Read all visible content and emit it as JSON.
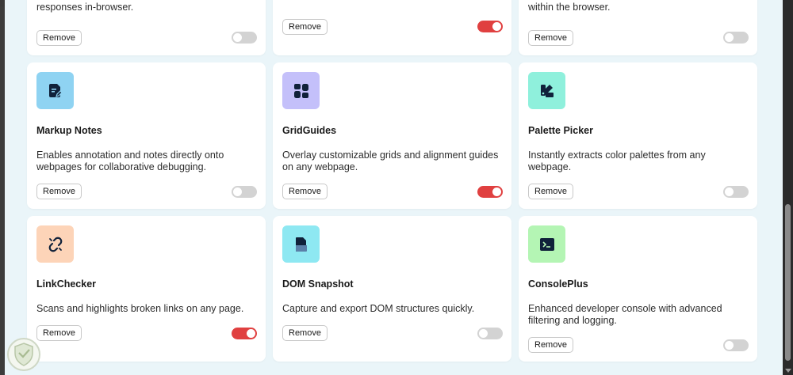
{
  "top_row": [
    {
      "desc_tail": "responses in-browser.",
      "remove_label": "Remove",
      "enabled": false
    },
    {
      "desc_tail": "",
      "remove_label": "Remove",
      "enabled": true
    },
    {
      "desc_tail": "within the browser.",
      "remove_label": "Remove",
      "enabled": false
    }
  ],
  "extensions": [
    {
      "name": "Markup Notes",
      "description": "Enables annotation and notes directly onto webpages for collaborative debugging.",
      "icon": "note-edit-icon",
      "icon_bg": "#8fd3f2",
      "remove_label": "Remove",
      "enabled": false
    },
    {
      "name": "GridGuides",
      "description": "Overlay customizable grids and alignment guides on any webpage.",
      "icon": "grid-icon",
      "icon_bg": "#c4c0fa",
      "remove_label": "Remove",
      "enabled": true
    },
    {
      "name": "Palette Picker",
      "description": "Instantly extracts color palettes from any webpage.",
      "icon": "palette-icon",
      "icon_bg": "#8ff0dc",
      "remove_label": "Remove",
      "enabled": false
    },
    {
      "name": "LinkChecker",
      "description": "Scans and highlights broken links on any page.",
      "icon": "broken-link-icon",
      "icon_bg": "#fdd4b8",
      "remove_label": "Remove",
      "enabled": true
    },
    {
      "name": "DOM Snapshot",
      "description": "Capture and export DOM structures quickly.",
      "icon": "document-icon",
      "icon_bg": "#8ee8f2",
      "remove_label": "Remove",
      "enabled": false
    },
    {
      "name": "ConsolePlus",
      "description": "Enhanced developer console with advanced filtering and logging.",
      "icon": "terminal-icon",
      "icon_bg": "#b4f5b4",
      "remove_label": "Remove",
      "enabled": false
    }
  ],
  "colors": {
    "toggle_on": "#e04040",
    "toggle_off": "#d3d3d3",
    "page_bg": "#eaf5f9"
  }
}
